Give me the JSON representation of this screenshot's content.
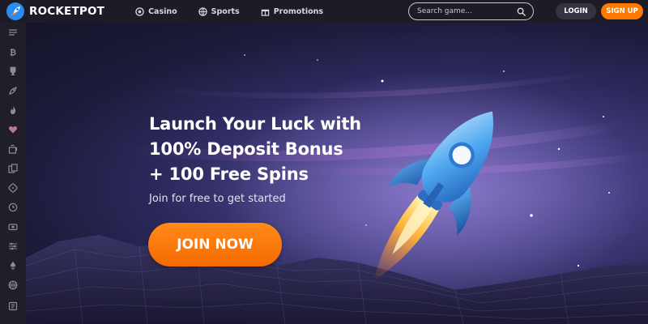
{
  "brand": {
    "name": "ROCKETPOT",
    "logo_icon": "rocket-logo-icon",
    "accent": "#ff7a00"
  },
  "nav": [
    {
      "label": "Casino",
      "icon": "casino-chip-icon"
    },
    {
      "label": "Sports",
      "icon": "ball-icon"
    },
    {
      "label": "Promotions",
      "icon": "gift-icon"
    }
  ],
  "search": {
    "placeholder": "Search game...",
    "value": "",
    "icon": "search-icon"
  },
  "auth": {
    "login_label": "LOGIN",
    "signup_label": "SIGN UP"
  },
  "sidebar": [
    {
      "icon": "menu-icon"
    },
    {
      "icon": "bitcoin-icon"
    },
    {
      "icon": "trophy-icon"
    },
    {
      "icon": "rocket-icon"
    },
    {
      "icon": "flame-icon"
    },
    {
      "icon": "heart-icon"
    },
    {
      "icon": "slot-machine-icon"
    },
    {
      "icon": "cards-icon"
    },
    {
      "icon": "dice-icon"
    },
    {
      "icon": "clock-icon"
    },
    {
      "icon": "live-casino-icon"
    },
    {
      "icon": "sliders-icon"
    },
    {
      "icon": "ethereum-icon"
    },
    {
      "icon": "basketball-icon"
    },
    {
      "icon": "card-table-icon"
    }
  ],
  "hero": {
    "title_lines": [
      "Launch Your Luck with",
      "100% Deposit Bonus",
      "+ 100 Free Spins"
    ],
    "subtitle": "Join for free to get started",
    "cta_label": "JOIN NOW"
  }
}
